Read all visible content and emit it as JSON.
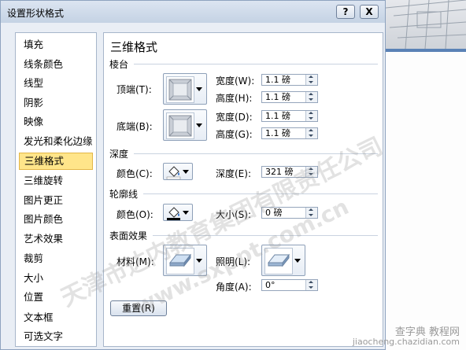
{
  "dialog": {
    "title": "设置形状格式",
    "help_label": "?",
    "close_label": "X"
  },
  "nav": {
    "items": [
      "填充",
      "线条颜色",
      "线型",
      "阴影",
      "映像",
      "发光和柔化边缘",
      "三维格式",
      "三维旋转",
      "图片更正",
      "图片颜色",
      "艺术效果",
      "裁剪",
      "大小",
      "位置",
      "文本框",
      "可选文字"
    ],
    "selected": "三维格式"
  },
  "panel": {
    "title": "三维格式",
    "bevel": {
      "section": "棱台",
      "top_label": "顶端(T):",
      "bottom_label": "底端(B):",
      "top_width_label": "宽度(W):",
      "top_width_value": "1.1 磅",
      "top_height_label": "高度(H):",
      "top_height_value": "1.1 磅",
      "bottom_width_label": "宽度(D):",
      "bottom_width_value": "1.1 磅",
      "bottom_height_label": "高度(G):",
      "bottom_height_value": "1.1 磅"
    },
    "depth": {
      "section": "深度",
      "color_label": "颜色(C):",
      "depth_label": "深度(E):",
      "depth_value": "321 磅"
    },
    "contour": {
      "section": "轮廓线",
      "color_label": "颜色(O):",
      "size_label": "大小(S):",
      "size_value": "0 磅"
    },
    "surface": {
      "section": "表面效果",
      "material_label": "材料(M):",
      "lighting_label": "照明(L):",
      "angle_label": "角度(A):",
      "angle_value": "0°"
    },
    "reset_label": "重置(R)"
  },
  "watermark": {
    "line1": "天津市达内教育集团有限责任公司",
    "line2": "www.sxppt.com.cn"
  },
  "corner_logo": {
    "line1": "查字典 教程网",
    "line2": "jiaocheng.chazidian.com"
  }
}
